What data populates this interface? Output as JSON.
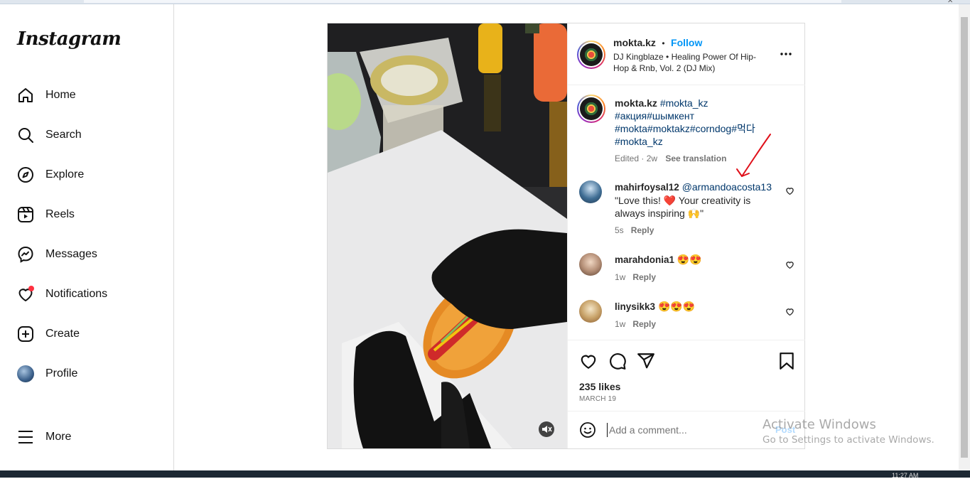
{
  "app": {
    "logo_text": "Instagram"
  },
  "sidebar": {
    "items": [
      {
        "label": "Home",
        "icon": "home-icon"
      },
      {
        "label": "Search",
        "icon": "search-icon"
      },
      {
        "label": "Explore",
        "icon": "compass-icon"
      },
      {
        "label": "Reels",
        "icon": "reels-icon"
      },
      {
        "label": "Messages",
        "icon": "messenger-icon"
      },
      {
        "label": "Notifications",
        "icon": "heart-icon"
      },
      {
        "label": "Create",
        "icon": "plus-square-icon"
      },
      {
        "label": "Profile",
        "icon": "avatar"
      }
    ],
    "more_label": "More"
  },
  "post": {
    "author": "mokta.kz",
    "separator": "•",
    "follow_label": "Follow",
    "audio": "DJ Kingblaze • Healing Power Of Hip-Hop & Rnb, Vol. 2 (DJ Mix)",
    "caption": {
      "author": "mokta.kz",
      "line1_tag": "#mokta_kz",
      "line2": "#акция#шымкент",
      "line3": "#mokta#moktakz#corndog#먹다",
      "line4": "#mokta_kz",
      "edited": "Edited · 2w",
      "see_translation": "See translation"
    },
    "comments": [
      {
        "user": "mahirfoysal12",
        "mention": "@armandoacosta13",
        "text_a": "\"Love this! ",
        "heart": "❤️",
        "text_b": " Your creativity is always inspiring ",
        "emoji_end": "🙌",
        "text_c": "\"",
        "time": "5s",
        "reply": "Reply"
      },
      {
        "user": "marahdonia1",
        "emoji": "😍😍",
        "time": "1w",
        "reply": "Reply"
      },
      {
        "user": "linysikk3",
        "emoji": "😍😍😍",
        "time": "1w",
        "reply": "Reply"
      }
    ],
    "likes": "235 likes",
    "date": "MARCH 19",
    "add_comment_placeholder": "Add a comment...",
    "post_label": "Post"
  },
  "watermark": {
    "line1": "Activate Windows",
    "line2": "Go to Settings to activate Windows."
  },
  "taskbar": {
    "clock": "11:27 AM"
  },
  "colors": {
    "accent": "#0095f6",
    "hashtag": "#00376b",
    "annotation_arrow": "#e0101a"
  }
}
